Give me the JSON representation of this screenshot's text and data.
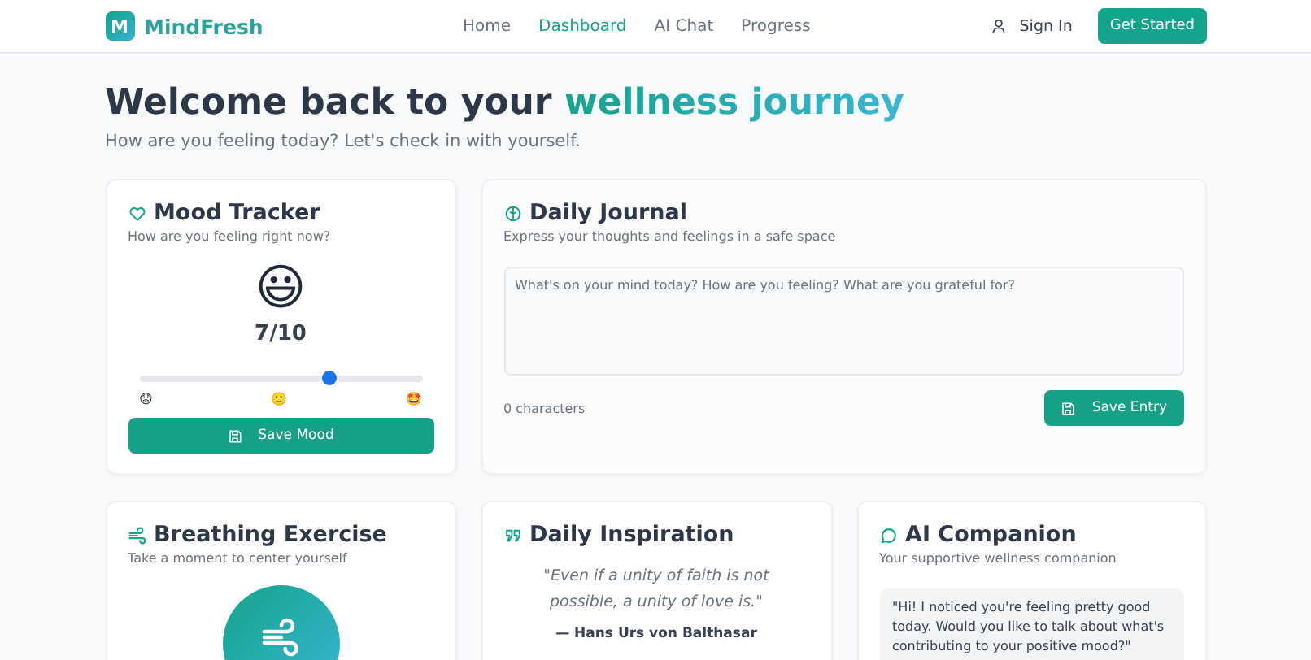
{
  "brand": {
    "logo_letter": "M",
    "name": "MindFresh"
  },
  "nav": [
    {
      "label": "Home",
      "selected": false
    },
    {
      "label": "Dashboard",
      "selected": true
    },
    {
      "label": "AI Chat",
      "selected": false
    },
    {
      "label": "Progress",
      "selected": false
    }
  ],
  "sign_in": "Sign In",
  "get_started": "Get Started",
  "hero": {
    "title": "Welcome back to your",
    "highlight": "wellness journey",
    "subtitle": "How are you feeling today? Let's check in with yourself."
  },
  "mood": {
    "title": "Mood Tracker",
    "subtitle": "How are you feeling right now?",
    "emoji": "😃",
    "score": "7/10",
    "level": 0.67,
    "scale": [
      "😟",
      "🙂",
      "🤩"
    ],
    "button": "Save Mood"
  },
  "journal": {
    "title": "Daily Journal",
    "subtitle": "Express your thoughts and feelings in a safe space",
    "placeholder": "What's on your mind today? How are you feeling? What are you grateful for?",
    "count": "0 characters",
    "button": "Save Entry"
  },
  "breathing": {
    "title": "Breathing Exercise",
    "subtitle": "Take a moment to center yourself"
  },
  "inspiration": {
    "title": "Daily Inspiration",
    "quote": "\"Even if a unity of faith is not possible, a unity of love is.\"",
    "author": "— Hans Urs von Balthasar"
  },
  "companion": {
    "title": "AI Companion",
    "subtitle": "Your supportive wellness companion",
    "message": "\"Hi! I noticed you're feeling pretty good today. Would you like to talk about what's contributing to your positive mood?\""
  }
}
